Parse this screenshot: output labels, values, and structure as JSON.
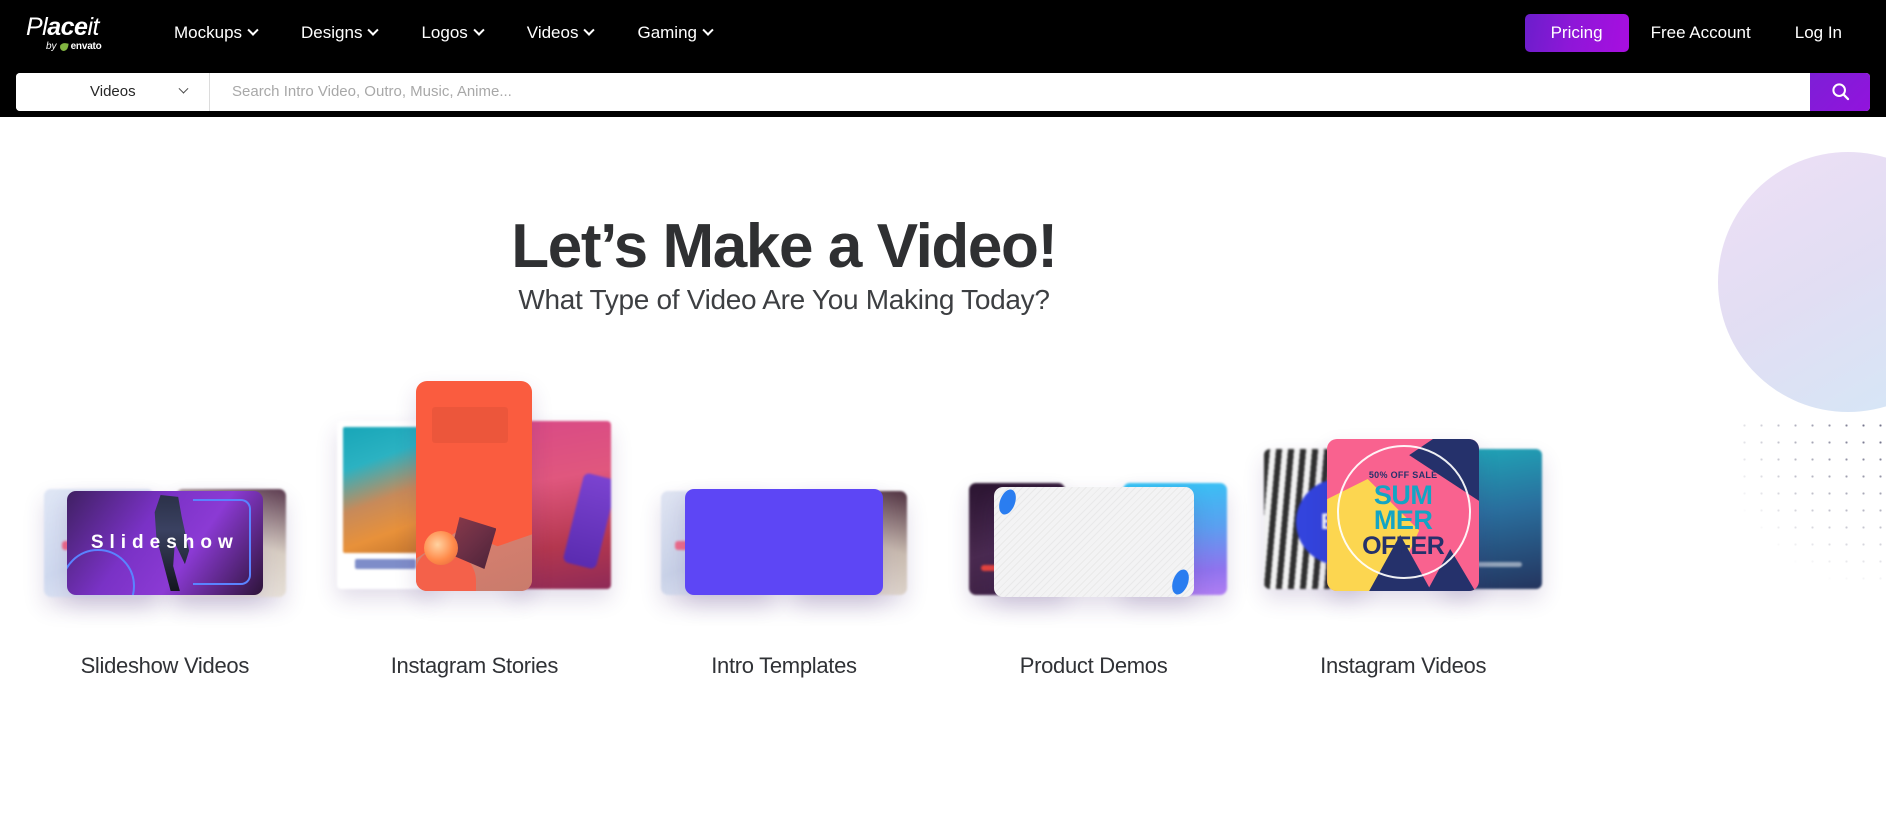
{
  "brand": {
    "logo_main_lt": "Pl",
    "logo_main_ace": "ace",
    "logo_main_it": "it",
    "logo_by": "by",
    "logo_envato": "envato"
  },
  "nav": {
    "items": [
      {
        "label": "Mockups",
        "icon": "chevron-down-icon"
      },
      {
        "label": "Designs",
        "icon": "chevron-down-icon"
      },
      {
        "label": "Logos",
        "icon": "chevron-down-icon"
      },
      {
        "label": "Videos",
        "icon": "chevron-down-icon"
      },
      {
        "label": "Gaming",
        "icon": "chevron-down-icon"
      }
    ],
    "pricing_label": "Pricing",
    "free_account_label": "Free Account",
    "login_label": "Log In",
    "pricing_gradient_from": "#6b1ecb",
    "pricing_gradient_to": "#a80ee0"
  },
  "search": {
    "category_value": "Videos",
    "category_icon": "chevron-down-icon",
    "placeholder": "Search Intro Video, Outro, Music, Anime...",
    "value": "",
    "button_icon": "search-icon",
    "button_color": "#8a18da"
  },
  "hero": {
    "title": "Let’s Make a Video!",
    "subtitle": "What Type of Video Are You Making Today?",
    "title_color": "#2f3032",
    "deco_circle_from": "#ead9f4",
    "deco_circle_to": "#c9e3f5"
  },
  "categories": [
    {
      "label": "Slideshow Videos",
      "art_word": "Slideshow",
      "accent": "#8b3ad4"
    },
    {
      "label": "Instagram Stories",
      "accent": "#fa5c3f"
    },
    {
      "label": "Intro Templates",
      "accent": "#5d46f5"
    },
    {
      "label": "Product Demos",
      "accent": "#2a7df0"
    },
    {
      "label": "Instagram Videos",
      "accent": "#f9628f",
      "poster": {
        "kicker": "50% OFF SALE",
        "line1": "SUM",
        "line2": "MER",
        "line3": "OFFER"
      },
      "left_thumb_text": "B S"
    }
  ]
}
